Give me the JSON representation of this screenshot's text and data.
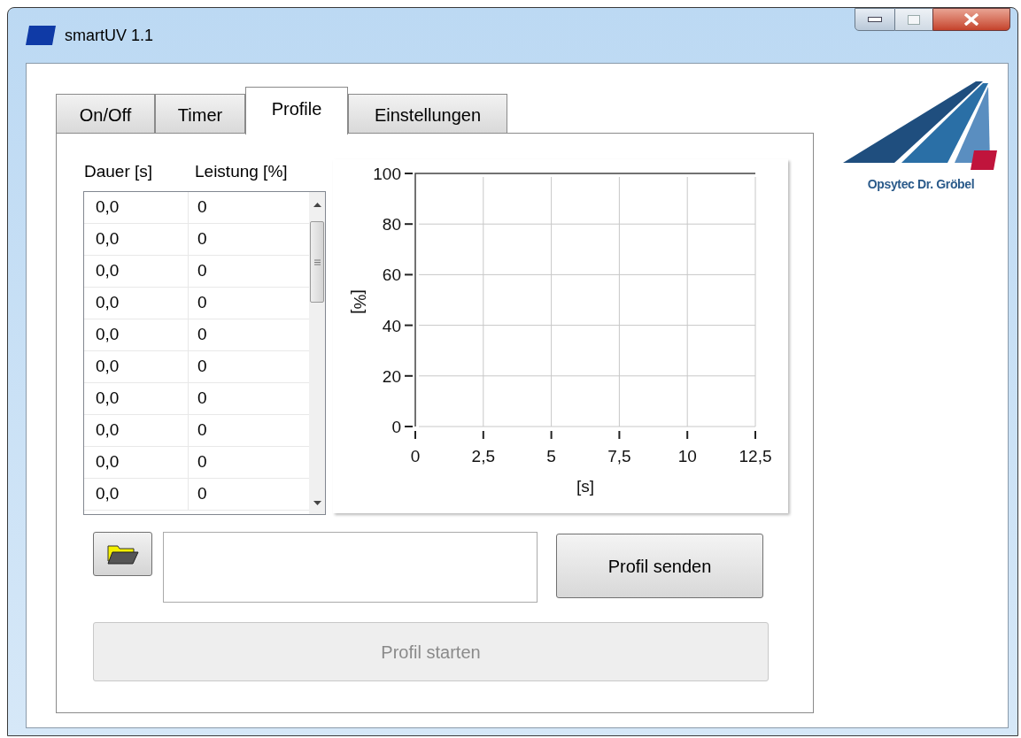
{
  "window": {
    "title": "smartUV 1.1"
  },
  "tabs": [
    {
      "label": "On/Off",
      "selected": false
    },
    {
      "label": "Timer",
      "selected": false
    },
    {
      "label": "Profile",
      "selected": true
    },
    {
      "label": "Einstellungen",
      "selected": false
    }
  ],
  "table": {
    "columns": [
      "Dauer [s]",
      "Leistung [%]"
    ],
    "rows": [
      [
        "0,0",
        "0"
      ],
      [
        "0,0",
        "0"
      ],
      [
        "0,0",
        "0"
      ],
      [
        "0,0",
        "0"
      ],
      [
        "0,0",
        "0"
      ],
      [
        "0,0",
        "0"
      ],
      [
        "0,0",
        "0"
      ],
      [
        "0,0",
        "0"
      ],
      [
        "0,0",
        "0"
      ],
      [
        "0,0",
        "0"
      ]
    ]
  },
  "chart": {
    "chart_data": {
      "type": "line",
      "xlabel": "[s]",
      "ylabel": "[%]",
      "xlim": [
        0,
        12.5
      ],
      "ylim": [
        0,
        100
      ],
      "xticks": [
        {
          "value": 0,
          "label": "0"
        },
        {
          "value": 2.5,
          "label": "2,5"
        },
        {
          "value": 5,
          "label": "5"
        },
        {
          "value": 7.5,
          "label": "7,5"
        },
        {
          "value": 10,
          "label": "10"
        },
        {
          "value": 12.5,
          "label": "12,5"
        }
      ],
      "yticks": [
        0,
        20,
        40,
        60,
        80,
        100
      ],
      "grid": true
    }
  },
  "buttons": [
    {
      "label": "Profil senden",
      "disabled": false
    },
    {
      "label": "Profil starten",
      "disabled": true
    }
  ],
  "logo": {
    "text": "Opsytec Dr. Gröbel"
  }
}
